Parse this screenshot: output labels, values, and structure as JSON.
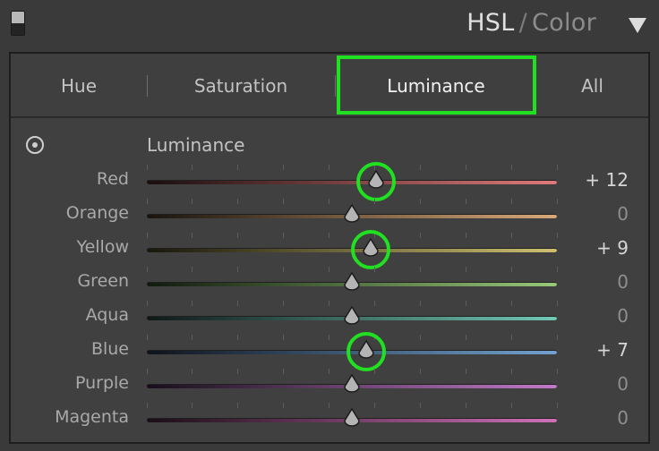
{
  "header": {
    "title_part1": "HSL",
    "title_separator": "/",
    "title_part2": "Color",
    "collapse_icon": "triangle-down-icon"
  },
  "tabs": [
    {
      "label": "Hue",
      "active": false
    },
    {
      "label": "Saturation",
      "active": false
    },
    {
      "label": "Luminance",
      "active": true
    },
    {
      "label": "All",
      "active": false
    }
  ],
  "section": {
    "icon": "target-adjust-icon",
    "label": "Luminance"
  },
  "slider_range": [
    -100,
    100
  ],
  "sliders": [
    {
      "label": "Red",
      "value": 12,
      "display": "+ 12",
      "gradient": [
        "#1a0e0e",
        "#e07a7a"
      ],
      "highlighted": true
    },
    {
      "label": "Orange",
      "value": 0,
      "display": "0",
      "gradient": [
        "#19140e",
        "#d8a878"
      ],
      "highlighted": false
    },
    {
      "label": "Yellow",
      "value": 9,
      "display": "+ 9",
      "gradient": [
        "#17170c",
        "#cfc070"
      ],
      "highlighted": true
    },
    {
      "label": "Green",
      "value": 0,
      "display": "0",
      "gradient": [
        "#101a0e",
        "#98c878"
      ],
      "highlighted": false
    },
    {
      "label": "Aqua",
      "value": 0,
      "display": "0",
      "gradient": [
        "#0e1817",
        "#72c8b6"
      ],
      "highlighted": false
    },
    {
      "label": "Blue",
      "value": 7,
      "display": "+ 7",
      "gradient": [
        "#0e131b",
        "#72a2d0"
      ],
      "highlighted": true
    },
    {
      "label": "Purple",
      "value": 0,
      "display": "0",
      "gradient": [
        "#180e1a",
        "#c07ac8"
      ],
      "highlighted": false
    },
    {
      "label": "Magenta",
      "value": 0,
      "display": "0",
      "gradient": [
        "#1a0e16",
        "#d070b8"
      ],
      "highlighted": false
    }
  ],
  "colors": {
    "highlight": "#21e021",
    "thumb": "#b4b4b4"
  }
}
